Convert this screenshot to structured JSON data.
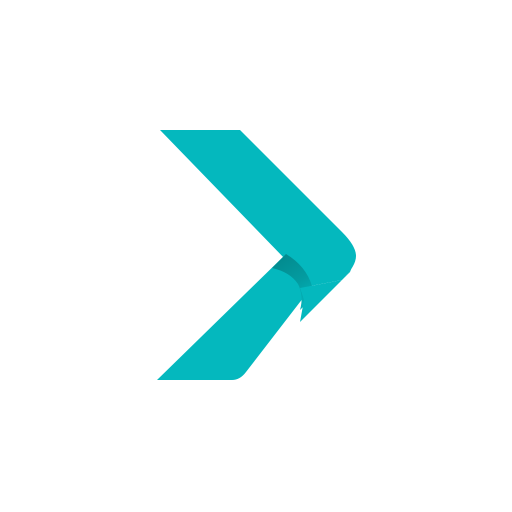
{
  "logo": {
    "icon": "chevron-right-logo-icon",
    "colors": {
      "primary": "#04B8BE",
      "shadow": "#03898D",
      "background": "#FFFFFF"
    }
  }
}
